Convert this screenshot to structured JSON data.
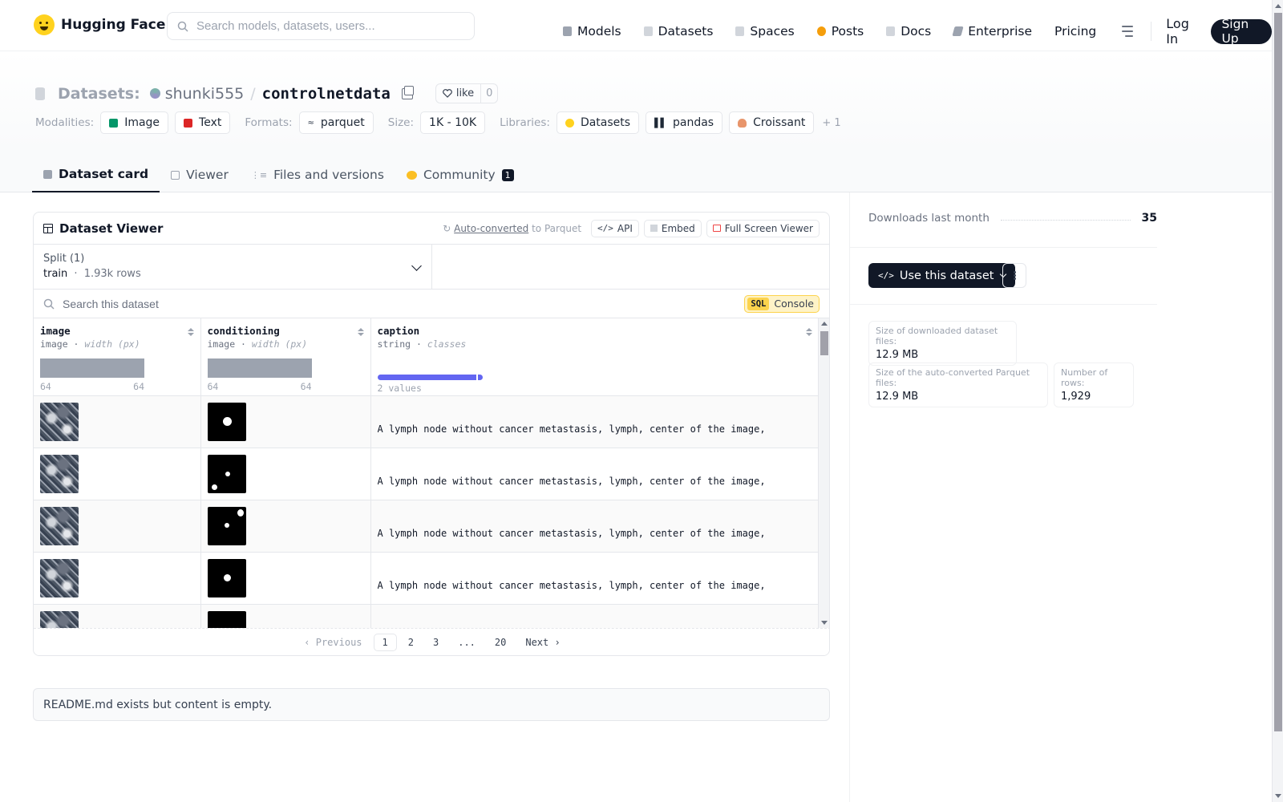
{
  "nav": {
    "brand": "Hugging Face",
    "search_placeholder": "Search models, datasets, users...",
    "links": [
      {
        "label": "Models",
        "icon": "models-icon",
        "color": "#9ca3af"
      },
      {
        "label": "Datasets",
        "icon": "datasets-icon",
        "color": "#9ca3af"
      },
      {
        "label": "Spaces",
        "icon": "spaces-icon",
        "color": "#9ca3af"
      },
      {
        "label": "Posts",
        "icon": "posts-icon",
        "color": "#f59e0b"
      },
      {
        "label": "Docs",
        "icon": "docs-icon",
        "color": "#9ca3af"
      },
      {
        "label": "Enterprise",
        "icon": "enterprise-icon",
        "color": "#6b7280"
      },
      {
        "label": "Pricing",
        "icon": "",
        "color": ""
      }
    ],
    "login": "Log In",
    "signup": "Sign Up"
  },
  "header": {
    "crumb_label": "Datasets:",
    "owner": "shunki555",
    "separator": "/",
    "repo": "controlnetdata",
    "like_label": "like",
    "like_count": "0",
    "modalities_label": "Modalities:",
    "modalities": [
      {
        "label": "Image",
        "color": "#059669"
      },
      {
        "label": "Text",
        "color": "#dc2626"
      }
    ],
    "formats_label": "Formats:",
    "formats": [
      "parquet"
    ],
    "size_label": "Size:",
    "size": "1K - 10K",
    "libraries_label": "Libraries:",
    "libraries": [
      "Datasets",
      "pandas",
      "Croissant"
    ],
    "libraries_more": "+ 1"
  },
  "tabs": [
    {
      "label": "Dataset card",
      "active": true
    },
    {
      "label": "Viewer",
      "active": false
    },
    {
      "label": "Files and versions",
      "active": false
    },
    {
      "label": "Community",
      "active": false,
      "badge": "1"
    }
  ],
  "viewer": {
    "title": "Dataset Viewer",
    "auto_converted_link": "Auto-converted",
    "auto_converted_suffix": "to Parquet",
    "api": "API",
    "embed": "Embed",
    "fullscreen": "Full Screen Viewer",
    "split_label": "Split (1)",
    "split_name": "train",
    "split_sep": "·",
    "split_rows": "1.93k rows",
    "search_placeholder": "Search this dataset",
    "sql_tag": "SQL",
    "sql_label": "Console",
    "columns": [
      {
        "name": "image",
        "type": "image",
        "stat": "width (px)",
        "min": "64",
        "max": "64"
      },
      {
        "name": "conditioning",
        "type": "image",
        "stat": "width (px)",
        "min": "64",
        "max": "64"
      },
      {
        "name": "caption",
        "type": "string",
        "stat": "classes",
        "summary": "2 values"
      }
    ],
    "rows": [
      {
        "caption": "A lymph node without cancer metastasis, lymph, center of the image,"
      },
      {
        "caption": "A lymph node without cancer metastasis, lymph, center of the image,"
      },
      {
        "caption": "A lymph node without cancer metastasis, lymph, center of the image,"
      },
      {
        "caption": "A lymph node without cancer metastasis, lymph, center of the image,"
      },
      {
        "caption": ""
      }
    ],
    "pager": {
      "previous": "Previous",
      "pages": [
        "1",
        "2",
        "3",
        "...",
        "20"
      ],
      "next": "Next",
      "current": "1"
    }
  },
  "readme": "README.md exists but content is empty.",
  "sidebar": {
    "downloads_label": "Downloads last month",
    "downloads_count": "35",
    "use_button": "Use this dataset",
    "stats": [
      {
        "label": "Size of downloaded dataset files:",
        "value": "12.9 MB"
      },
      {
        "label": "Size of the auto-converted Parquet files:",
        "value": "12.9 MB"
      },
      {
        "label": "Number of rows:",
        "value": "1,929"
      }
    ]
  }
}
